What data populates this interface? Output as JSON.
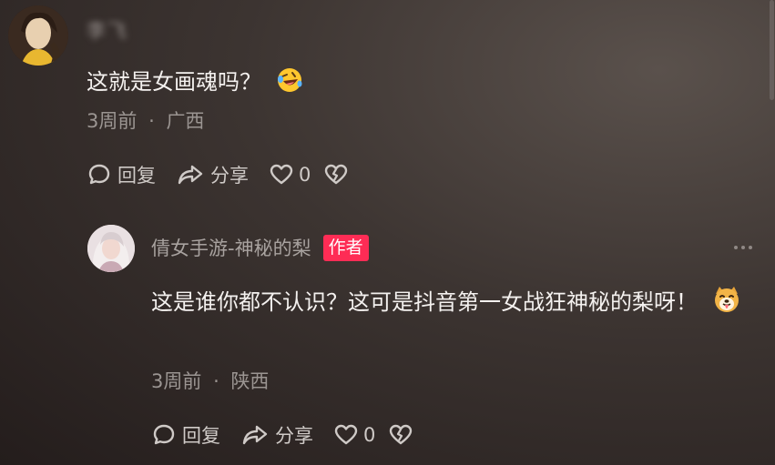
{
  "comment": {
    "username": "李飞",
    "text": "这就是女画魂吗？",
    "emoji": "rolling-on-floor-laughing-icon",
    "time": "3周前",
    "separator": "·",
    "location": "广西",
    "reply_label": "回复",
    "share_label": "分享",
    "like_count": "0"
  },
  "reply": {
    "username": "倩女手游-神秘的梨",
    "author_badge": "作者",
    "text": "这是谁你都不认识？这可是抖音第一女战狂神秘的梨呀！",
    "emoji": "dog-face-tongue-icon",
    "time": "3周前",
    "separator": "·",
    "location": "陕西",
    "reply_label": "回复",
    "share_label": "分享",
    "like_count": "0"
  },
  "colors": {
    "badge": "#fe2c55",
    "text_primary": "#f4f1ef",
    "text_secondary": "#9b9592"
  }
}
